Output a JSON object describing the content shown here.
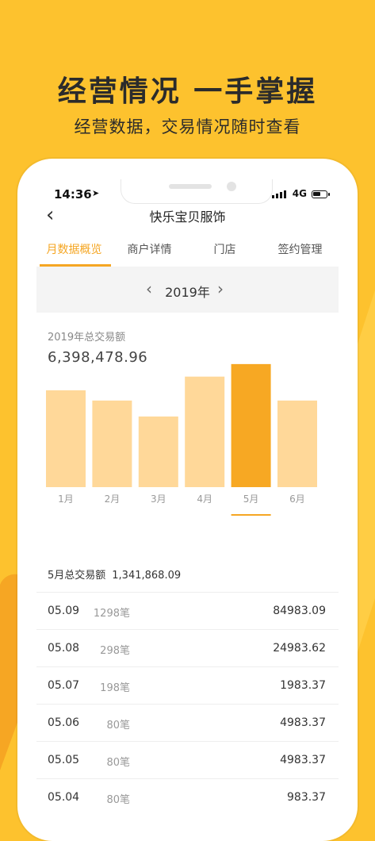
{
  "promo": {
    "headline": "经营情况 一手掌握",
    "subline": "经营数据，交易情况随时查看"
  },
  "status_bar": {
    "time": "14:36",
    "location_icon": "➤",
    "network": "4G",
    "battery_level": 0.6
  },
  "navbar": {
    "back_icon": "‹",
    "title": "快乐宝贝服饰"
  },
  "tabs": [
    {
      "label": "月数据概览",
      "active": true
    },
    {
      "label": "商户详情",
      "active": false
    },
    {
      "label": "门店",
      "active": false
    },
    {
      "label": "签约管理",
      "active": false
    }
  ],
  "year_selector": {
    "prev_icon": "‹",
    "year": "2019年",
    "next_icon": "›"
  },
  "summary": {
    "label": "2019年总交易额",
    "value": "6,398,478.96"
  },
  "colors": {
    "accent": "#F5A623",
    "bar_normal": "#FFD899",
    "bar_selected": "#F7A823",
    "background": "#FDC22E"
  },
  "chart_data": {
    "type": "bar",
    "categories": [
      "1月",
      "2月",
      "3月",
      "4月",
      "5月",
      "6月"
    ],
    "values": [
      85,
      76,
      62,
      97,
      108,
      76
    ],
    "selected_index": 4,
    "ylim": [
      0,
      110
    ],
    "grid": false
  },
  "month_summary": {
    "label": "5月总交易额",
    "value": "1,341,868.09"
  },
  "transactions": [
    {
      "date": "05.09",
      "count": "1298笔",
      "amount": "84983.09"
    },
    {
      "date": "05.08",
      "count": "298笔",
      "amount": "24983.62"
    },
    {
      "date": "05.07",
      "count": "198笔",
      "amount": "1983.37"
    },
    {
      "date": "05.06",
      "count": "80笔",
      "amount": "4983.37"
    },
    {
      "date": "05.05",
      "count": "80笔",
      "amount": "4983.37"
    },
    {
      "date": "05.04",
      "count": "80笔",
      "amount": "983.37"
    }
  ]
}
